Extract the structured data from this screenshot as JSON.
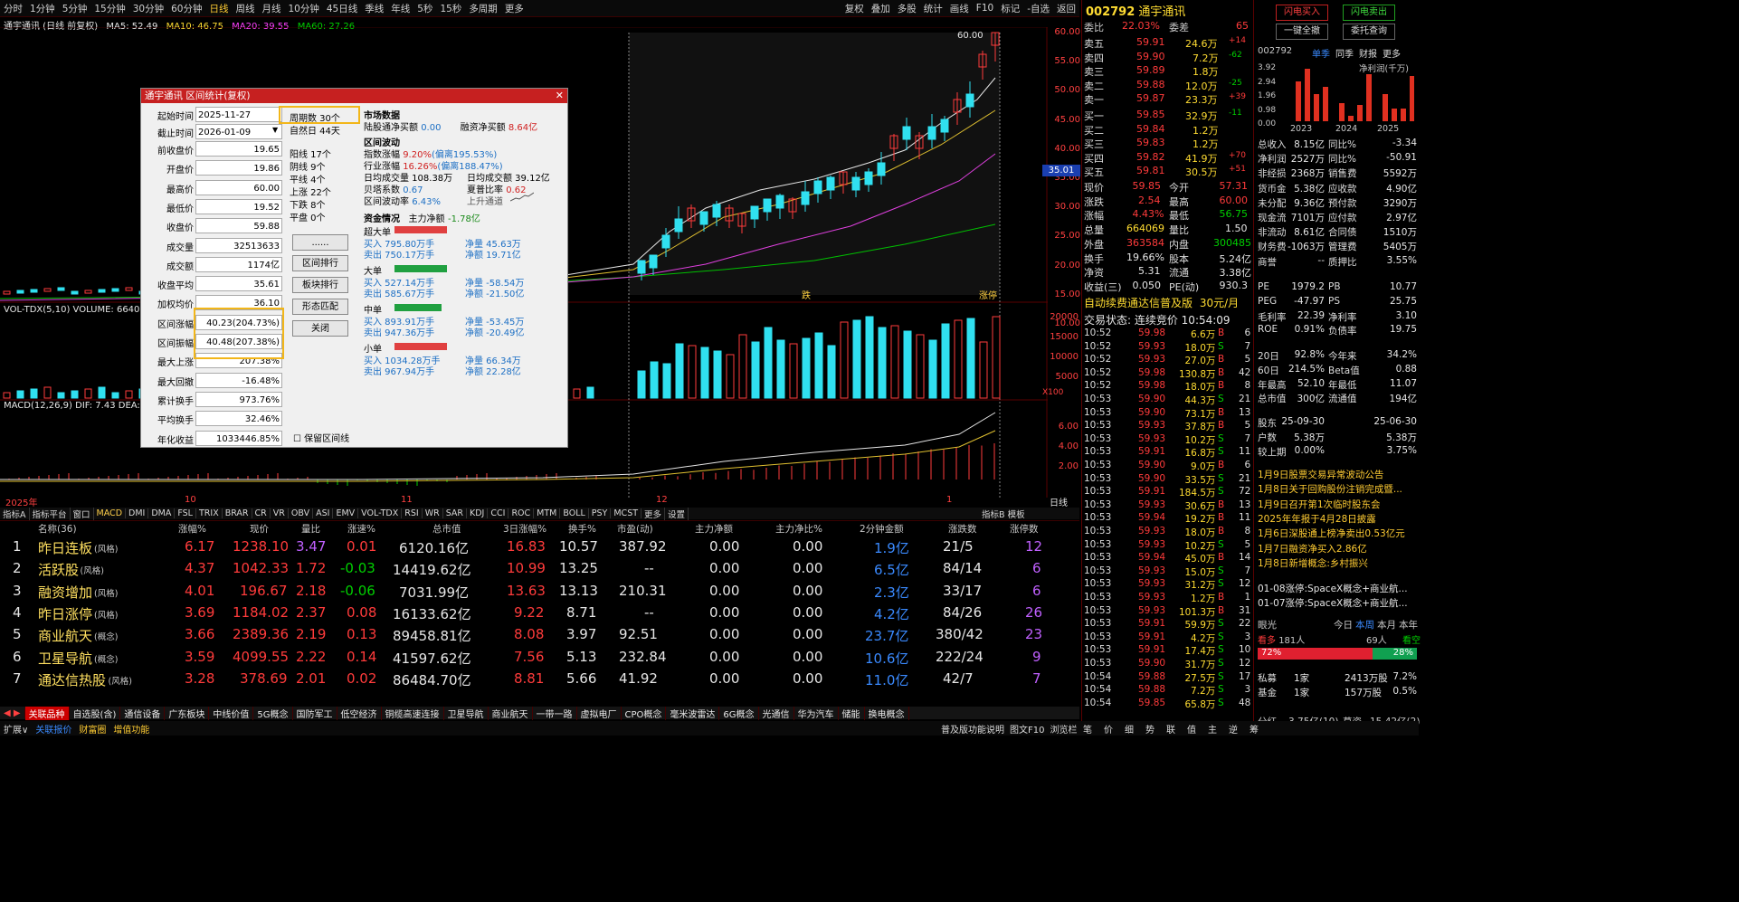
{
  "toolbar": {
    "periods": [
      "分时",
      "1分钟",
      "5分钟",
      "15分钟",
      "30分钟",
      "60分钟",
      "日线",
      "周线",
      "月线",
      "10分钟",
      "45日线",
      "季线",
      "年线",
      "5秒",
      "15秒",
      "多周期",
      "更多"
    ],
    "active_period": "日线",
    "right_tools": [
      "复权",
      "叠加",
      "多股",
      "统计",
      "画线",
      "F10",
      "标记",
      "-自选",
      "返回"
    ]
  },
  "chart": {
    "title": "通宇通讯 (日线 前复权)",
    "ma5": "MA5: 52.49",
    "ma10": "MA10: 46.75",
    "ma20": "MA20: 39.55",
    "ma60": "MA60: 27.26",
    "price_ticks": [
      "60.00",
      "55.00",
      "50.00",
      "45.00",
      "40.00",
      "35.00",
      "30.00",
      "25.00",
      "20.00",
      "15.00",
      "10.00"
    ],
    "high_label": "60.00",
    "current_tag": "35.01",
    "markers": [
      "跌",
      "涨停"
    ],
    "vol_label": "VOL-TDX(5,10) VOLUME: 6640",
    "vol_ticks": [
      "20000",
      "15000",
      "10000",
      "5000"
    ],
    "vol_unit": "X100",
    "macd_label": "MACD(12,26,9) DIF: 7.43 DEA:",
    "macd_ticks": [
      "6.00",
      "4.00",
      "2.00"
    ],
    "x_labels": [
      "2025年",
      "10",
      "11",
      "12",
      "1"
    ],
    "x_period": "日线"
  },
  "dialog": {
    "title": "通宇通讯 区间统计(复权)",
    "start_label": "起始时间",
    "start_value": "2025-11-27",
    "end_label": "截止时间",
    "end_value": "2026-01-09",
    "period_count": "周期数 30个",
    "natural_days": "自然日 44天",
    "rows": [
      {
        "label": "前收盘价",
        "value": "19.65"
      },
      {
        "label": "开盘价",
        "value": "19.86"
      },
      {
        "label": "最高价",
        "value": "60.00"
      },
      {
        "label": "最低价",
        "value": "19.52"
      },
      {
        "label": "收盘价",
        "value": "59.88"
      },
      {
        "label": "成交量",
        "value": "32513633"
      },
      {
        "label": "成交额",
        "value": "1174亿"
      },
      {
        "label": "收盘平均",
        "value": "35.61"
      },
      {
        "label": "加权均价",
        "value": "36.10"
      },
      {
        "label": "区间涨幅",
        "value": "40.23(204.73%)"
      },
      {
        "label": "区间振幅",
        "value": "40.48(207.38%)"
      },
      {
        "label": "最大上涨",
        "value": "207.38%"
      },
      {
        "label": "最大回撤",
        "value": "-16.48%"
      },
      {
        "label": "累计换手",
        "value": "973.76%"
      },
      {
        "label": "平均换手",
        "value": "32.46%"
      },
      {
        "label": "年化收益",
        "value": "1033446.85%"
      }
    ],
    "counts": [
      "阳线 17个",
      "阴线 9个",
      "平线 4个",
      "上涨 22个",
      "下跌 8个",
      "平盘 0个"
    ],
    "buttons": [
      "......",
      "区间排行",
      "板块排行",
      "形态匹配",
      "关闭"
    ],
    "keep_label": "保留区间线",
    "market_title": "市场数据",
    "market_line1": "陆股通净买额",
    "market_v1": "0.00",
    "market_line2": "融资净买额",
    "market_v2": "8.64亿",
    "wave_title": "区间波动",
    "wave": [
      {
        "k": "指数涨幅",
        "v": "9.20%",
        "x": "(偏离195.53%)"
      },
      {
        "k": "行业涨幅",
        "v": "16.26%",
        "x": "(偏离188.47%)"
      }
    ],
    "avg_vol": "日均成交量 108.38万",
    "avg_amt": "日均成交额 39.12亿",
    "beta": "贝塔系数",
    "beta_v": "0.67",
    "sharpe": "夏普比率",
    "sharpe_v": "0.62",
    "volatility": "区间波动率",
    "volatility_v": "6.43%",
    "channel": "上升通道",
    "fund_title": "资金情况",
    "main_net_label": "主力净额",
    "main_net": "-1.78亿",
    "orders": [
      {
        "name": "超大单",
        "buy": "795.80万手",
        "sell": "750.17万手",
        "net": "45.63万",
        "pct": "19.71亿"
      },
      {
        "name": "大单",
        "buy": "527.14万手",
        "sell": "585.67万手",
        "net": "-58.54万",
        "pct": "-21.50亿"
      },
      {
        "name": "中单",
        "buy": "893.91万手",
        "sell": "947.36万手",
        "net": "-53.45万",
        "pct": "-20.49亿"
      },
      {
        "name": "小单",
        "buy": "1034.28万手",
        "sell": "967.94万手",
        "net": "66.34万",
        "pct": "22.28亿"
      }
    ]
  },
  "indicator_tabs": [
    "指标A",
    "指标平台",
    "窗口",
    "MACD",
    "DMI",
    "DMA",
    "FSL",
    "TRIX",
    "BRAR",
    "CR",
    "VR",
    "OBV",
    "ASI",
    "EMV",
    "VOL-TDX",
    "RSI",
    "WR",
    "SAR",
    "KDJ",
    "CCI",
    "ROC",
    "MTM",
    "BOLL",
    "PSY",
    "MCST",
    "更多",
    "设置"
  ],
  "indicator_right": [
    "指标B",
    "模板"
  ],
  "list": {
    "headers": [
      "名称(36)",
      "涨幅%",
      "现价",
      "量比",
      "涨速%",
      "总市值",
      "3日涨幅%",
      "换手%",
      "市盈(动)",
      "主力净额",
      "主力净比%",
      "2分钟金额",
      "涨跌数",
      "涨停数"
    ],
    "rows": [
      {
        "n": "1",
        "name": "昨日连板",
        "tag": "(风格)",
        "chg": "6.17",
        "price": "1238.10",
        "vr": "3.47",
        "spd": "0.01",
        "cap": "6120.16亿",
        "d3": "16.83",
        "to": "10.57",
        "pe": "387.92",
        "mn": "0.00",
        "mp": "0.00",
        "amt": "1.9亿",
        "ud": "21/5",
        "zt": "12"
      },
      {
        "n": "2",
        "name": "活跃股",
        "tag": "(风格)",
        "chg": "4.37",
        "price": "1042.33",
        "vr": "1.72",
        "spd": "-0.03",
        "cap": "14419.62亿",
        "d3": "10.99",
        "to": "13.25",
        "pe": "--",
        "mn": "0.00",
        "mp": "0.00",
        "amt": "6.5亿",
        "ud": "84/14",
        "zt": "6"
      },
      {
        "n": "3",
        "name": "融资增加",
        "tag": "(风格)",
        "chg": "4.01",
        "price": "196.67",
        "vr": "2.18",
        "spd": "-0.06",
        "cap": "7031.99亿",
        "d3": "13.63",
        "to": "13.13",
        "pe": "210.31",
        "mn": "0.00",
        "mp": "0.00",
        "amt": "2.3亿",
        "ud": "33/17",
        "zt": "6"
      },
      {
        "n": "4",
        "name": "昨日涨停",
        "tag": "(风格)",
        "chg": "3.69",
        "price": "1184.02",
        "vr": "2.37",
        "spd": "0.08",
        "cap": "16133.62亿",
        "d3": "9.22",
        "to": "8.71",
        "pe": "--",
        "mn": "0.00",
        "mp": "0.00",
        "amt": "4.2亿",
        "ud": "84/26",
        "zt": "26"
      },
      {
        "n": "5",
        "name": "商业航天",
        "tag": "(概念)",
        "chg": "3.66",
        "price": "2389.36",
        "vr": "2.19",
        "spd": "0.13",
        "cap": "89458.81亿",
        "d3": "8.08",
        "to": "3.97",
        "pe": "92.51",
        "mn": "0.00",
        "mp": "0.00",
        "amt": "23.7亿",
        "ud": "380/42",
        "zt": "23"
      },
      {
        "n": "6",
        "name": "卫星导航",
        "tag": "(概念)",
        "chg": "3.59",
        "price": "4099.55",
        "vr": "2.22",
        "spd": "0.14",
        "cap": "41597.62亿",
        "d3": "7.56",
        "to": "5.13",
        "pe": "232.84",
        "mn": "0.00",
        "mp": "0.00",
        "amt": "10.6亿",
        "ud": "222/24",
        "zt": "9"
      },
      {
        "n": "7",
        "name": "通达信热股",
        "tag": "(风格)",
        "chg": "3.28",
        "price": "378.69",
        "vr": "2.01",
        "spd": "0.02",
        "cap": "86484.70亿",
        "d3": "8.81",
        "to": "5.66",
        "pe": "41.92",
        "mn": "0.00",
        "mp": "0.00",
        "amt": "11.0亿",
        "ud": "42/7",
        "zt": "7"
      }
    ]
  },
  "sector_tabs": [
    "关联品种",
    "自选股(含)",
    "通信设备",
    "广东板块",
    "中线价值",
    "5G概念",
    "国防军工",
    "低空经济",
    "铜缆高速连接",
    "卫星导航",
    "商业航天",
    "一带一路",
    "虚拟电厂",
    "CPO概念",
    "毫米波雷达",
    "6G概念",
    "光通信",
    "华为汽车",
    "储能",
    "换电概念"
  ],
  "bottom": {
    "left": [
      "扩展∨",
      "关联报价",
      "财富圈",
      "增值功能"
    ],
    "right": [
      "普及版功能说明",
      "图文F10",
      "浏览栏"
    ],
    "right_tabs": [
      "笔",
      "价",
      "细",
      "势",
      "联",
      "值",
      "主",
      "逆",
      "筹"
    ],
    "far_bottom_k": "分红",
    "far_bottom_v": "3.75亿(10)",
    "far_bottom_k2": "募资",
    "far_bottom_v2": "15.42亿(2)"
  },
  "quote": {
    "code": "002792",
    "name": "通宇通讯",
    "wb_label": "委比",
    "wb": "22.03%",
    "wc_label": "委差",
    "wc": "65",
    "asks": [
      {
        "l": "卖五",
        "p": "59.91",
        "v": "24.6万",
        "d": "+14"
      },
      {
        "l": "卖四",
        "p": "59.90",
        "v": "7.2万",
        "d": "-62"
      },
      {
        "l": "卖三",
        "p": "59.89",
        "v": "1.8万",
        "d": ""
      },
      {
        "l": "卖二",
        "p": "59.88",
        "v": "12.0万",
        "d": "-25"
      },
      {
        "l": "卖一",
        "p": "59.87",
        "v": "23.3万",
        "d": "+39"
      }
    ],
    "bids": [
      {
        "l": "买一",
        "p": "59.85",
        "v": "32.9万",
        "d": "-11"
      },
      {
        "l": "买二",
        "p": "59.84",
        "v": "1.2万",
        "d": ""
      },
      {
        "l": "买三",
        "p": "59.83",
        "v": "1.2万",
        "d": ""
      },
      {
        "l": "买四",
        "p": "59.82",
        "v": "41.9万",
        "d": "+70"
      },
      {
        "l": "买五",
        "p": "59.81",
        "v": "30.5万",
        "d": "+51"
      }
    ],
    "stats": [
      {
        "a": "现价",
        "av": "59.85",
        "b": "今开",
        "bv": "57.31"
      },
      {
        "a": "涨跌",
        "av": "2.54",
        "b": "最高",
        "bv": "60.00"
      },
      {
        "a": "涨幅",
        "av": "4.43%",
        "b": "最低",
        "bv": "56.75"
      },
      {
        "a": "总量",
        "av": "664069",
        "b": "量比",
        "bv": "1.50"
      },
      {
        "a": "外盘",
        "av": "363584",
        "b": "内盘",
        "bv": "300485"
      },
      {
        "a": "换手",
        "av": "19.66%",
        "b": "股本",
        "bv": "5.24亿"
      },
      {
        "a": "净资",
        "av": "5.31",
        "b": "流通",
        "bv": "3.38亿"
      },
      {
        "a": "收益(三)",
        "av": "0.050",
        "b": "PE(动)",
        "bv": "930.3"
      }
    ],
    "ad": "自动续费通达信普及版",
    "ad_price": "30元/月",
    "trade_state": "交易状态: 连续竞价 10:54:09",
    "ticks": [
      [
        "10:52",
        "59.98",
        "6.6万",
        "B",
        "6"
      ],
      [
        "10:52",
        "59.93",
        "18.0万",
        "S",
        "7"
      ],
      [
        "10:52",
        "59.93",
        "27.0万",
        "B",
        "5"
      ],
      [
        "10:52",
        "59.98",
        "130.8万",
        "B",
        "42"
      ],
      [
        "10:52",
        "59.98",
        "18.0万",
        "B",
        "8"
      ],
      [
        "10:53",
        "59.90",
        "44.3万",
        "S",
        "21"
      ],
      [
        "10:53",
        "59.90",
        "73.1万",
        "B",
        "13"
      ],
      [
        "10:53",
        "59.93",
        "37.8万",
        "B",
        "5"
      ],
      [
        "10:53",
        "59.93",
        "10.2万",
        "S",
        "7"
      ],
      [
        "10:53",
        "59.91",
        "16.8万",
        "S",
        "11"
      ],
      [
        "10:53",
        "59.90",
        "9.0万",
        "B",
        "6"
      ],
      [
        "10:53",
        "59.90",
        "33.5万",
        "S",
        "21"
      ],
      [
        "10:53",
        "59.91",
        "184.5万",
        "S",
        "72"
      ],
      [
        "10:53",
        "59.93",
        "30.6万",
        "B",
        "13"
      ],
      [
        "10:53",
        "59.94",
        "19.2万",
        "B",
        "11"
      ],
      [
        "10:53",
        "59.93",
        "18.0万",
        "B",
        "8"
      ],
      [
        "10:53",
        "59.93",
        "10.2万",
        "S",
        "5"
      ],
      [
        "10:53",
        "59.94",
        "45.0万",
        "B",
        "14"
      ],
      [
        "10:53",
        "59.93",
        "15.0万",
        "S",
        "7"
      ],
      [
        "10:53",
        "59.93",
        "31.2万",
        "S",
        "12"
      ],
      [
        "10:53",
        "59.93",
        "1.2万",
        "B",
        "1"
      ],
      [
        "10:53",
        "59.93",
        "101.3万",
        "B",
        "31"
      ],
      [
        "10:53",
        "59.91",
        "59.9万",
        "S",
        "22"
      ],
      [
        "10:53",
        "59.91",
        "4.2万",
        "S",
        "3"
      ],
      [
        "10:53",
        "59.91",
        "17.4万",
        "S",
        "10"
      ],
      [
        "10:53",
        "59.90",
        "31.7万",
        "S",
        "12"
      ],
      [
        "10:54",
        "59.88",
        "27.5万",
        "S",
        "17"
      ],
      [
        "10:54",
        "59.88",
        "7.2万",
        "S",
        "3"
      ],
      [
        "10:54",
        "59.85",
        "65.8万",
        "S",
        "48"
      ]
    ]
  },
  "far": {
    "btn1": "闪电买入",
    "btn2": "闪电卖出",
    "btn3": "一键全撤",
    "btn4": "委托查询",
    "code": "002792",
    "tabs": [
      "单季",
      "同季",
      "财报",
      "更多"
    ],
    "net_profit": "净利润(千万)",
    "y_ticks": [
      "3.92",
      "2.94",
      "1.96",
      "0.98",
      "0.00"
    ],
    "years": [
      "2023",
      "2024",
      "2025"
    ],
    "fin": [
      {
        "a": "总收入",
        "av": "8.15亿",
        "b": "同比%",
        "bv": "-3.34"
      },
      {
        "a": "净利润",
        "av": "2527万",
        "b": "同比%",
        "bv": "-50.91"
      },
      {
        "a": "非经损",
        "av": "2368万",
        "b": "销售费",
        "bv": "5592万"
      },
      {
        "a": "货币金",
        "av": "5.38亿",
        "b": "应收款",
        "bv": "4.90亿"
      },
      {
        "a": "未分配",
        "av": "9.36亿",
        "b": "预付款",
        "bv": "3290万"
      },
      {
        "a": "现金流",
        "av": "7101万",
        "b": "应付款",
        "bv": "2.97亿"
      },
      {
        "a": "非流动",
        "av": "8.61亿",
        "b": "合同债",
        "bv": "1510万"
      },
      {
        "a": "财务费",
        "av": "-1063万",
        "b": "管理费",
        "bv": "5405万"
      },
      {
        "a": "商誉",
        "av": "--",
        "b": "质押比",
        "bv": "3.55%"
      }
    ],
    "val": [
      {
        "a": "PE",
        "av": "1979.2",
        "b": "PB",
        "bv": "10.77"
      },
      {
        "a": "PEG",
        "av": "-47.97",
        "b": "PS",
        "bv": "25.75"
      },
      {
        "a": "毛利率",
        "av": "22.39",
        "b": "净利率",
        "bv": "3.10"
      },
      {
        "a": "ROE",
        "av": "0.91%",
        "b": "负债率",
        "bv": "19.75"
      }
    ],
    "perf": [
      {
        "a": "20日",
        "av": "92.8%",
        "b": "今年来",
        "bv": "34.2%"
      },
      {
        "a": "60日",
        "av": "214.5%",
        "b": "Beta值",
        "bv": "0.88"
      },
      {
        "a": "年最高",
        "av": "52.10",
        "b": "年最低",
        "bv": "11.07"
      },
      {
        "a": "总市值",
        "av": "300亿",
        "b": "流通值",
        "bv": "194亿"
      }
    ],
    "holders": [
      {
        "a": "股东",
        "av": "25-09-30",
        "bv": "25-06-30"
      },
      {
        "a": "户数",
        "av": "5.38万",
        "bv": "5.38万"
      },
      {
        "a": "较上期",
        "av": "0.00%",
        "bv": "3.75%"
      }
    ],
    "news": [
      "1月9日股票交易异常波动公告",
      "1月8日关于回购股份注销完成暨...",
      "1月9日召开第1次临时股东会",
      "2025年年报于4月28日披露",
      "1月6日深股通上榜净卖出0.53亿元",
      "1月7日融资净买入2.86亿",
      "1月8日新增概念:乡村振兴",
      "01-08涨停:SpaceX概念+商业航...",
      "01-07涨停:SpaceX概念+商业航..."
    ],
    "eye_label": "眼光",
    "eye_tabs": [
      "今日",
      "本周",
      "本月",
      "本年"
    ],
    "bull_label": "看多",
    "bull_count": "181人",
    "bear_count": "69人",
    "bear_label": "看空",
    "bull_pct": "72%",
    "bear_pct": "28%",
    "inst": [
      {
        "a": "私募",
        "av": "1家",
        "b": "2413万股",
        "bv": "7.2%"
      },
      {
        "a": "基金",
        "av": "1家",
        "b": "157万股",
        "bv": "0.5%"
      }
    ]
  }
}
